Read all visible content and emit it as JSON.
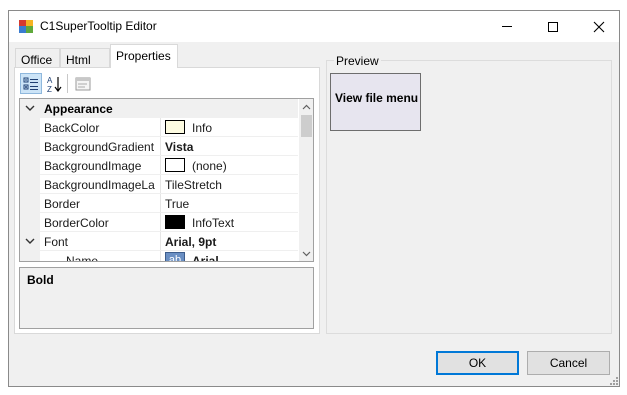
{
  "window": {
    "title": "C1SuperTooltip Editor",
    "controls": {
      "minimize": "minimize-icon",
      "maximize": "maximize-icon",
      "close": "close-icon"
    }
  },
  "tabs": [
    {
      "label": "Office",
      "selected": false
    },
    {
      "label": "Html",
      "selected": false
    },
    {
      "label": "Properties",
      "selected": true
    }
  ],
  "property_grid": {
    "toolbar": [
      {
        "icon": "categorized-icon",
        "active": true
      },
      {
        "icon": "alphabetical-sort-icon",
        "active": false
      },
      {
        "icon": "property-pages-icon",
        "active": false
      }
    ],
    "category": "Appearance",
    "rows": [
      {
        "name": "BackColor",
        "value": "Info",
        "swatch": "#fdfbe1"
      },
      {
        "name": "BackgroundGradient",
        "value": "Vista",
        "bold": true
      },
      {
        "name": "BackgroundImage",
        "value": "(none)",
        "swatch": "#ffffff"
      },
      {
        "name": "BackgroundImageLa",
        "value": "TileStretch"
      },
      {
        "name": "Border",
        "value": "True"
      },
      {
        "name": "BorderColor",
        "value": "InfoText",
        "swatch": "#000000"
      },
      {
        "name": "Font",
        "value": "Arial, 9pt",
        "bold": true,
        "expandable": true
      },
      {
        "name": "Name",
        "value": "Arial",
        "bold": true,
        "icon_text": "ab"
      }
    ],
    "description": {
      "title": "Bold"
    }
  },
  "preview": {
    "legend": "Preview",
    "tooltip_text": "View file menu"
  },
  "buttons": {
    "ok": "OK",
    "cancel": "Cancel"
  },
  "colors": {
    "accent": "#0078d7",
    "tooltip_bg": "#e7e5ef",
    "selected_tool": "#cce4f7"
  }
}
